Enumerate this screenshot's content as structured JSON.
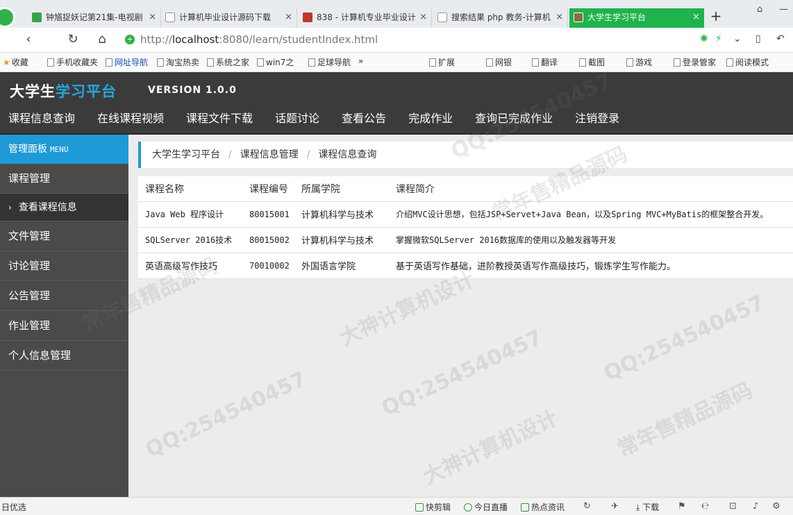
{
  "browser": {
    "tabs": [
      {
        "title": "钟馗捉妖记第21集-电视剧",
        "icon_color": "#3aa34a"
      },
      {
        "title": "计算机毕业设计源码下载",
        "icon_color": "#ffffff"
      },
      {
        "title": "838 - 计算机专业毕业设计",
        "icon_color": "#c0392b"
      },
      {
        "title": "搜索结果 php 教务-计算机",
        "icon_color": "#ffffff"
      },
      {
        "title": "大学生学习平台",
        "icon_color": "#8a6d3b"
      }
    ],
    "tab_close": "×",
    "new_tab": "+",
    "url_prefix": "http://",
    "url_host": "localhost",
    "url_rest": ":8080/learn/studentIndex.html",
    "bookmarks": [
      "收藏",
      "手机收藏夹",
      "网址导航",
      "淘宝热卖",
      "系统之家",
      "win7之",
      "足球导航",
      "»"
    ],
    "toolbar_right": [
      "扩展",
      "网银",
      "翻译",
      "截图",
      "游戏",
      "登录管家",
      "阅读模式"
    ]
  },
  "app": {
    "brand_part1": "大学生",
    "brand_part2": "学习平台",
    "version": "VERSION 1.0.0",
    "nav": [
      "课程信息查询",
      "在线课程视频",
      "课程文件下载",
      "话题讨论",
      "查看公告",
      "完成作业",
      "查询已完成作业",
      "注销登录"
    ]
  },
  "sidebar": {
    "head": "管理面板",
    "head_sub": "MENU",
    "group1": "课程管理",
    "sub_chev": "›",
    "sub_item": "查看课程信息",
    "items": [
      "文件管理",
      "讨论管理",
      "公告管理",
      "作业管理",
      "个人信息管理"
    ]
  },
  "breadcrumb": [
    "大学生学习平台",
    "课程信息管理",
    "课程信息查询"
  ],
  "breadcrumb_sep": "/",
  "table": {
    "headers": [
      "课程名称",
      "课程编号",
      "所属学院",
      "课程简介"
    ],
    "rows": [
      [
        "Java Web 程序设计",
        "80015001",
        "计算机科学与技术",
        "介绍MVC设计思想，包括JSP+Servet+Java Bean，以及Spring MVC+MyBatis的框架整合开发。"
      ],
      [
        "SQLServer 2016技术",
        "80015002",
        "计算机科学与技术",
        "掌握微软SQLServer 2016数据库的使用以及触发器等开发"
      ],
      [
        "英语高级写作技巧",
        "70010002",
        "外国语言学院",
        "基于英语写作基础，进阶教授英语写作高级技巧，锻炼学生写作能力。"
      ]
    ]
  },
  "status": {
    "left": "日优选",
    "items": [
      "快剪辑",
      "今日直播",
      "热点资讯",
      "下载"
    ]
  },
  "watermarks": [
    "QQ:254540457",
    "常年售精品源码",
    "大神计算机设计"
  ],
  "colors": {
    "accent": "#1e9ad6",
    "header_bg": "#3b3b3b",
    "sidebar_bg": "#4a4a4a",
    "tab_active": "#1fb34c"
  }
}
